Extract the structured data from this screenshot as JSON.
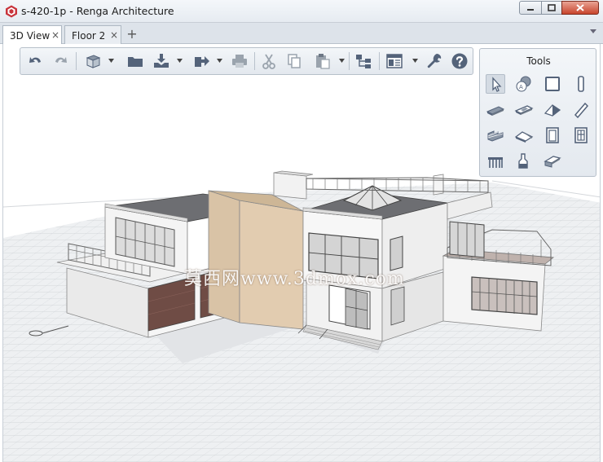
{
  "window": {
    "title": "s-420-1p - Renga Architecture",
    "app_icon": "renga-logo-icon",
    "controls": [
      "minimize-icon",
      "maximize-icon",
      "close-icon"
    ]
  },
  "tabs": [
    {
      "label": "3D View",
      "close": "×",
      "active": true
    },
    {
      "label": "Floor 2",
      "close": "×",
      "active": false
    }
  ],
  "tab_add": "+",
  "toolbar": {
    "buttons": [
      "undo-icon",
      "redo-icon",
      "view-cube-icon",
      "open-folder-icon",
      "import-icon",
      "export-icon",
      "print-icon",
      "cut-icon",
      "copy-icon",
      "paste-icon",
      "structure-icon",
      "layout-icon",
      "settings-wrench-icon",
      "help-icon"
    ]
  },
  "tools": {
    "title": "Tools",
    "items": [
      "select-icon",
      "style-icon",
      "wall-icon",
      "column-icon",
      "slab-icon",
      "floor-icon",
      "roof-icon",
      "beam-icon",
      "stair-icon",
      "ramp-icon",
      "door-icon",
      "window-icon",
      "railing-icon",
      "equipment-icon",
      "element-icon"
    ]
  },
  "viewport": {
    "watermark": "莫西网www.3dmox.com"
  },
  "colors": {
    "accent_close": "#c8452d",
    "facade_beige": "#e2ccb0",
    "roof_gray": "#6d6e72"
  }
}
